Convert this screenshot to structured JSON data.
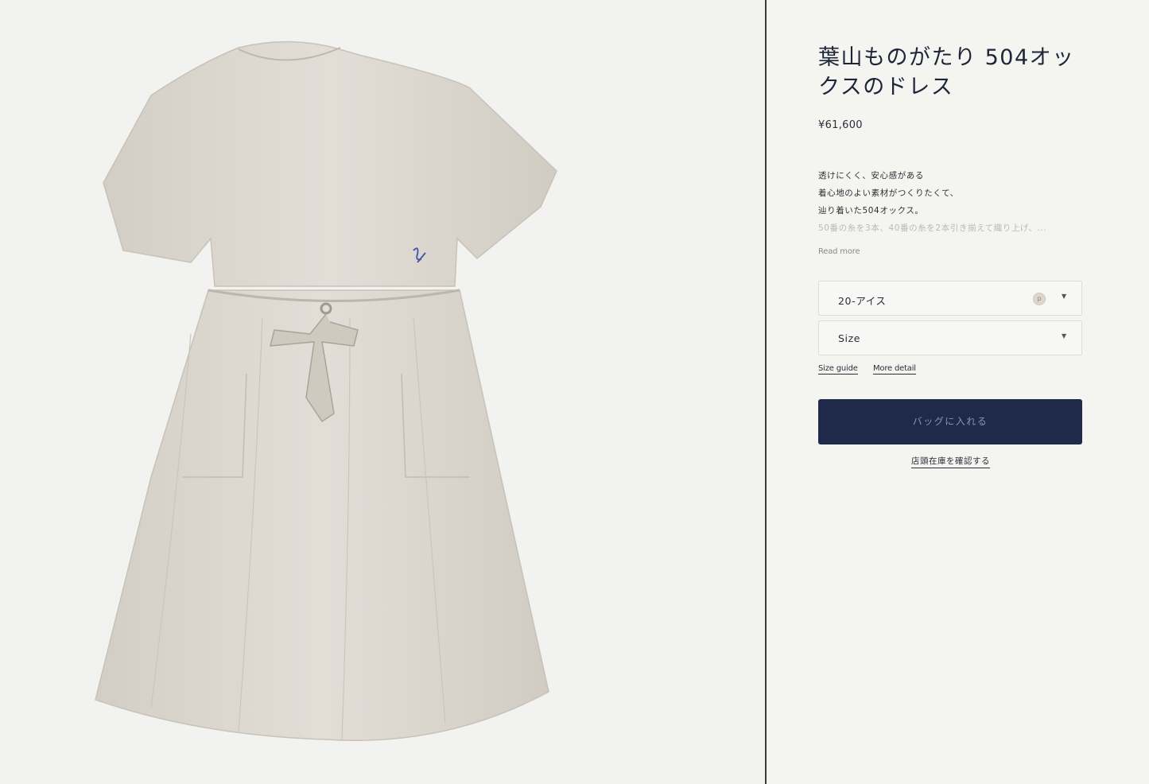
{
  "product": {
    "title": "葉山ものがたり 504オックスのドレス",
    "price": "¥61,600",
    "description": [
      "透けにくく、安心感がある",
      "着心地のよい素材がつくりたくて、",
      "辿り着いた504オックス。",
      "50番の糸を3本、40番の糸を2本引き揃えて織り上げ、..."
    ],
    "read_more": "Read more"
  },
  "options": {
    "color": {
      "value": "20-アイス",
      "swatch_letter": "p",
      "swatch_color": "#dcd6cd"
    },
    "size": {
      "value": "Size"
    }
  },
  "links": {
    "size_guide": "Size guide",
    "more_detail": "More detail",
    "store_stock": "店頭在庫を確認する"
  },
  "actions": {
    "add_to_bag": "バッグに入れる"
  },
  "colors": {
    "accent_navy": "#1f2a4a",
    "dress": "#dcd7cf",
    "embroidery": "#4a5aa8"
  }
}
